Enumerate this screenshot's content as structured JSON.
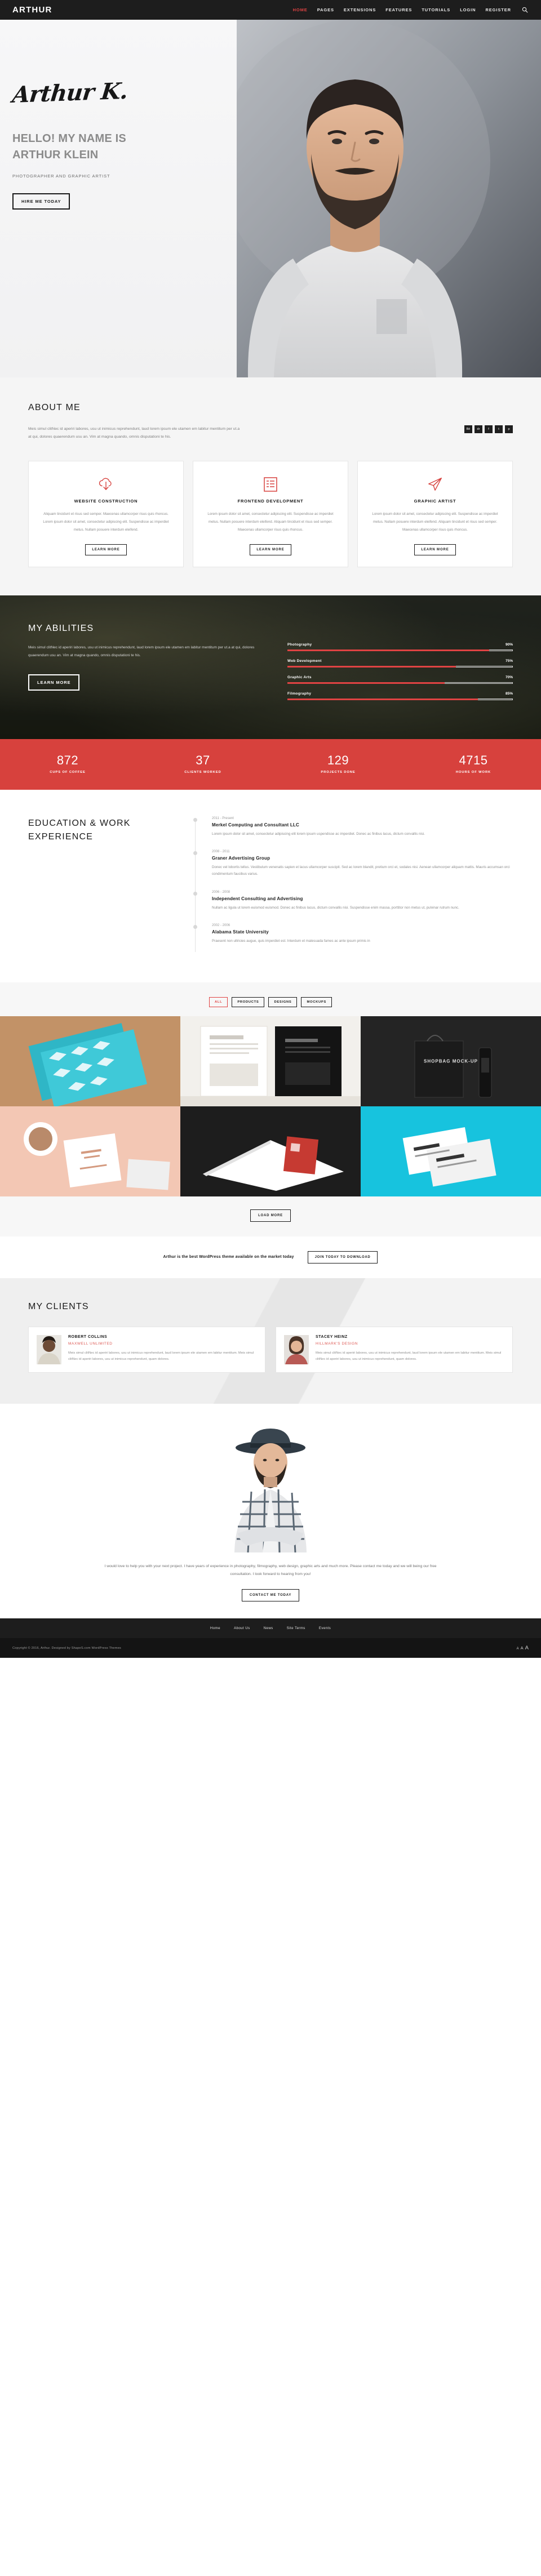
{
  "header": {
    "logo": "ARTHUR",
    "nav": [
      {
        "label": "HOME",
        "active": true
      },
      {
        "label": "PAGES",
        "active": false
      },
      {
        "label": "EXTENSIONS",
        "active": false
      },
      {
        "label": "FEATURES",
        "active": false
      },
      {
        "label": "TUTORIALS",
        "active": false
      },
      {
        "label": "LOGIN",
        "active": false
      },
      {
        "label": "REGISTER",
        "active": false
      }
    ],
    "search_icon": "search-icon",
    "accent": "#e04343",
    "background": "#1d1d1d"
  },
  "hero": {
    "signature": "Arthur K.",
    "title_line1": "HELLO! MY NAME IS",
    "title_line2": "ARTHUR KLEIN",
    "subtitle": "PHOTOGRAPHER AND GRAPHIC ARTIST",
    "cta": "HIRE ME TODAY"
  },
  "about": {
    "title": "ABOUT ME",
    "paragraph": "Meis simul clitNec id aperiri labores, usu ut inimicus reprehendunt, laud lorem ipsum ele utamen em labitur mentitum per ut.a at qui, dolores quaerendum usu an. Vim at magna quando, omnis disputationi te his.",
    "socials": [
      {
        "name": "behance-icon",
        "glyph": "Bē"
      },
      {
        "name": "dribbble-icon",
        "glyph": "dr"
      },
      {
        "name": "facebook-icon",
        "glyph": "f"
      },
      {
        "name": "twitter-icon",
        "glyph": "t"
      },
      {
        "name": "pinterest-icon",
        "glyph": "p"
      }
    ],
    "cards": [
      {
        "icon": "cloud-download-icon",
        "title": "WEBSITE CONSTRUCTION",
        "text": "Aliquam tincidunt et risus sed semper. Maecenas ullamcorper risus quis rhoncus. Lorem ipsum dolor sit amet, consectetur adipiscing elit. Suspendisse ac imperdiet metus. Nullam posuere interdum eleifend.",
        "button": "LEARN MORE"
      },
      {
        "icon": "list-document-icon",
        "title": "FRONTEND DEVELOPMENT",
        "text": "Lorem ipsum dolor sit amet, consectetur adipiscing elit. Suspendisse ac imperdiet metus. Nullam posuere interdum eleifend. Aliquam tincidunt et risus sed semper. Maecenas ullamcorper risus quis rhoncus.",
        "button": "LEARN MORE"
      },
      {
        "icon": "paper-plane-icon",
        "title": "GRAPHIC ARTIST",
        "text": "Lorem ipsum dolor sit amet, consectetur adipiscing elit. Suspendisse ac imperdiet metus. Nullam posuere interdum eleifend. Aliquam tincidunt et risus sed semper. Maecenas ullamcorper risus quis rhoncus.",
        "button": "LEARN MORE"
      }
    ]
  },
  "abilities": {
    "title": "MY ABILITIES",
    "paragraph": "Meis simul clitNec id aperiri labores, usu ut inimicus reprehendunt, laud lorem ipsum ele utamen em labitur mentitum per ut.a at qui, dolores quaerendum usu an. Vim at magna quando, omnis disputationi te his.",
    "button": "LEARN MORE",
    "skills": [
      {
        "name": "Photography",
        "value": 90,
        "label": "90%"
      },
      {
        "name": "Web Development",
        "value": 75,
        "label": "75%"
      },
      {
        "name": "Graphic Arts",
        "value": 70,
        "label": "70%"
      },
      {
        "name": "Filmography",
        "value": 85,
        "label": "85%"
      }
    ]
  },
  "counters": [
    {
      "number": "872",
      "label": "CUPS OF COFFEE"
    },
    {
      "number": "37",
      "label": "CLIENTS WORKED"
    },
    {
      "number": "129",
      "label": "PROJECTS DONE"
    },
    {
      "number": "4715",
      "label": "HOURS OF WORK"
    }
  ],
  "experience": {
    "title": "EDUCATION & WORK EXPERIENCE",
    "items": [
      {
        "date": "2011 - Present",
        "org": "Merkel Computing and Consultant LLC",
        "desc": "Lorem ipsum dolor sit amet, consectetur adipiscing elit lorem ipsum uspendisse ac imperdiet. Donec ac finibus lacus, dictum convallis nisi."
      },
      {
        "date": "2008 - 2011",
        "org": "Graner Advertising Group",
        "desc": "Donec vel lobortis tellus. Vestibulum venenatis sapien et lacus ullamcorper suscipit. Sed ac lorem blandit, pretium orci et, sodales nisi. Aenean ullamcorper aliquam mattis. Mauris accumsan orci condimentum faucibus varius."
      },
      {
        "date": "2006 - 2008",
        "org": "Independent Consulting and Advertising",
        "desc": "Nullam ac ligula ut lorem euismod euismod. Donec ac finibus lacus, dictum convallis nisi. Suspendisse enim massa, porttitor non metus ut, pulvinar rutrum nunc."
      },
      {
        "date": "2002 - 2006",
        "org": "Alabama State University",
        "desc": "Praesent non ultricies augue, quis imperdiet est. Interdum et malesuada fames ac ante ipsum primis in"
      }
    ]
  },
  "portfolio": {
    "filters": [
      {
        "label": "ALL",
        "active": true
      },
      {
        "label": "PRODUCTS",
        "active": false
      },
      {
        "label": "DESIGNS",
        "active": false
      },
      {
        "label": "MOCKUPS",
        "active": false
      }
    ],
    "tiles": [
      {
        "name": "notebooks-geometric-pattern",
        "label": "",
        "c1": "#d6a878",
        "c2": "#3fb8c4",
        "textcolor": "#ffffff"
      },
      {
        "name": "magazine-spread-mockup",
        "label": "",
        "c1": "#f3f1ec",
        "c2": "#dcd8d0",
        "textcolor": "#555555"
      },
      {
        "name": "shopping-bag-mockup",
        "label": "SHOPBAG MOCK-UP",
        "c1": "#2b2b2b",
        "c2": "#1a1a1a",
        "textcolor": "#ffffff"
      },
      {
        "name": "coffee-cup-branding",
        "label": "",
        "c1": "#f3c9b8",
        "c2": "#e8b49f",
        "textcolor": "#7a4a3a"
      },
      {
        "name": "red-notebook-mockup",
        "label": "",
        "c1": "#2a2a2a",
        "c2": "#161616",
        "textcolor": "#ffffff"
      },
      {
        "name": "business-cards-mockup",
        "label": "",
        "c1": "#17c3de",
        "c2": "#0fa9c6",
        "textcolor": "#ffffff"
      }
    ],
    "load_more": "LOAD MORE"
  },
  "cta": {
    "text": "Arthur is the best WordPress theme available on the market today",
    "button": "JOIN TODAY TO DOWNLOAD"
  },
  "clients": {
    "title": "MY CLIENTS",
    "items": [
      {
        "name": "ROBERT COLLINS",
        "company": "MAXWELL UNLIMITED",
        "text": "Meis simul clitNec id aperiri labores, usu ut inimicus reprehendunt, laud lorem ipsum ele utamen em labitur mentitum. Meis simul clitNec id aperiri labores, usu ut inimicus reprehendunt, quam dolores.",
        "photo": "client-photo-robert"
      },
      {
        "name": "STACEY HEINZ",
        "company": "HILLMARK'S DESIGN",
        "text": "Meis simul clitNec id aperiri labores, usu ut inimicus reprehendunt, laud lorem ipsum ele utamen em labitur mentitum. Meis simul clitNec id aperiri labores, usu ut inimicus reprehendunt, quam dolores.",
        "photo": "client-photo-stacey"
      }
    ]
  },
  "contact": {
    "text": "I would love to help you with your next project. I have years of experience in photography, filmography, web design, graphic arts and much more. Please contact me today and we will being our free consultation. I look forward to hearing from you!",
    "button": "CONTACT ME TODAY"
  },
  "footer": {
    "nav": [
      "Home",
      "About Us",
      "News",
      "Site Terms",
      "Events"
    ],
    "copyright": "Copyright © 2016, Arthur. Designed by ShapeS.com WordPress Themes",
    "fontsizes": [
      "A",
      "A",
      "A"
    ]
  }
}
